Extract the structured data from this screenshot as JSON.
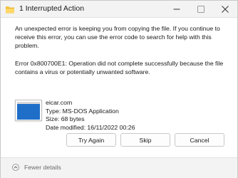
{
  "window": {
    "title": "1 Interrupted Action",
    "icons": {
      "app": "explorer-folder-icon",
      "minimize": "minimize-icon",
      "maximize": "maximize-icon",
      "close": "close-icon"
    }
  },
  "message": {
    "body": "An unexpected error is keeping you from copying the file. If you continue to receive this error, you can use the error code to search for help with this problem.",
    "error": "Error 0x800700E1: Operation did not complete successfully because the file contains a virus or potentially unwanted software."
  },
  "file": {
    "icon": "application-file-icon",
    "name": "eicar.com",
    "type": "Type: MS-DOS Application",
    "size": "Size: 68 bytes",
    "date": "Date modified: 16/11/2022 00:26"
  },
  "buttons": {
    "try_again": "Try Again",
    "skip": "Skip",
    "cancel": "Cancel"
  },
  "footer": {
    "fewer_details": "Fewer details",
    "icon": "chevron-up-icon"
  },
  "colors": {
    "titlebar_bg": "#f3f3f3",
    "footer_bg": "#f3f3f3",
    "folder_yellow": "#f5c542",
    "file_blue": "#1f6fc9"
  }
}
